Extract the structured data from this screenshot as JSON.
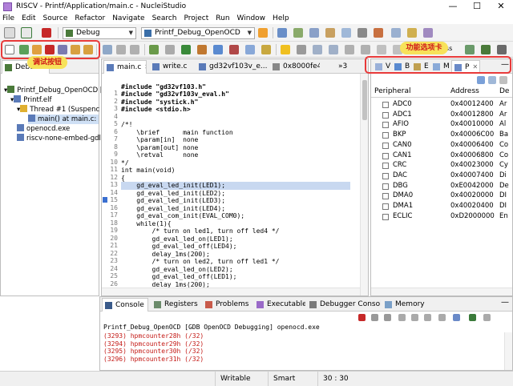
{
  "window": {
    "title": "RISCV - Printf/Application/main.c - NucleiStudio",
    "minimize": "—",
    "maximize": "☐",
    "close": "✕"
  },
  "menu": [
    "File",
    "Edit",
    "Source",
    "Refactor",
    "Navigate",
    "Search",
    "Project",
    "Run",
    "Window",
    "Help"
  ],
  "toolbar": {
    "mode_combo": "Debug",
    "launch_combo": "Printf_Debug_OpenOCD",
    "quick_access": "ess"
  },
  "annotations": {
    "debug_buttons": "调试按钮",
    "feature_tabs": "功能选项卡"
  },
  "debug_view": {
    "tab_label": "Debu",
    "items": [
      "Printf_Debug_OpenOCD [",
      "Printf.elf",
      "Thread #1 (Suspenc",
      "main() at main.c:",
      "openocd.exe",
      "riscv-none-embed-gdl"
    ]
  },
  "editor": {
    "tabs": [
      "main.c",
      "write.c",
      "gd32vf103v_e...",
      "0x8000fe4"
    ],
    "overflow": "»3",
    "line_numbers": [
      "1",
      "2",
      "3",
      "4",
      "5",
      "6",
      "7",
      "8",
      "9",
      "10",
      "11",
      "12",
      "13",
      "14",
      "15",
      "16",
      "17",
      "18",
      "19",
      "20",
      "21",
      "22",
      "23",
      "24",
      "25",
      "26",
      "27",
      "28"
    ],
    "lines": [
      "",
      "#include \"gd32vf103.h\"",
      "#include \"gd32vf103v_eval.h\"",
      "#include \"systick.h\"",
      "#include <stdio.h>",
      "",
      "/*!",
      "    \\brief      main function",
      "    \\param[in]  none",
      "    \\param[out] none",
      "    \\retval     none",
      "*/",
      "int main(void)",
      "{",
      "    gd_eval_led_init(LED1);",
      "    gd_eval_led_init(LED2);",
      "    gd_eval_led_init(LED3);",
      "    gd_eval_led_init(LED4);",
      "    gd_eval_com_init(EVAL_COM0);",
      "    while(1){",
      "        /* turn on led1, turn off led4 */",
      "        gd_eval_led_on(LED1);",
      "        gd_eval_led_off(LED4);",
      "        delay_1ms(200);",
      "        /* turn on led2, turn off led1 */",
      "        gd_eval_led_on(LED2);",
      "        gd_eval_led_off(LED1);",
      "        delay_1ms(200);"
    ]
  },
  "peripherals": {
    "tabs": [
      "V",
      "B",
      "E",
      "M",
      "P"
    ],
    "headers": [
      "Peripheral",
      "Address",
      "De"
    ],
    "rows": [
      {
        "name": "ADC0",
        "address": "0x40012400",
        "desc": "Ar"
      },
      {
        "name": "ADC1",
        "address": "0x40012800",
        "desc": "Ar"
      },
      {
        "name": "AFIO",
        "address": "0x40010000",
        "desc": "Al"
      },
      {
        "name": "BKP",
        "address": "0x40006C00",
        "desc": "Ba"
      },
      {
        "name": "CAN0",
        "address": "0x40006400",
        "desc": "Co"
      },
      {
        "name": "CAN1",
        "address": "0x40006800",
        "desc": "Co"
      },
      {
        "name": "CRC",
        "address": "0x40023000",
        "desc": "Cy"
      },
      {
        "name": "DAC",
        "address": "0x40007400",
        "desc": "Di"
      },
      {
        "name": "DBG",
        "address": "0xE0042000",
        "desc": "De"
      },
      {
        "name": "DMA0",
        "address": "0x40020000",
        "desc": "DI"
      },
      {
        "name": "DMA1",
        "address": "0x40020400",
        "desc": "DI"
      },
      {
        "name": "ECLIC",
        "address": "0xD2000000",
        "desc": "En"
      }
    ]
  },
  "bottom_tabs": [
    "Console",
    "Registers",
    "Problems",
    "Executables",
    "Debugger Console",
    "Memory"
  ],
  "console": {
    "header": "Printf_Debug_OpenOCD [GDB OpenOCD Debugging] openocd.exe",
    "lines": [
      "(3293) hpmcounter28h (/32)",
      "(3294) hpmcounter29h (/32)",
      "(3295) hpmcounter30h (/32)",
      "(3296) hpmcounter31h (/32)"
    ]
  },
  "status": {
    "writable": "Writable",
    "insert_mode": "Smart Insert",
    "position": "30 : 30"
  },
  "colors": {
    "callout_bg": "#f7e25a",
    "callout_text": "#d01818",
    "annotation_border": "#e83a3a",
    "console_text": "#c41a16"
  }
}
